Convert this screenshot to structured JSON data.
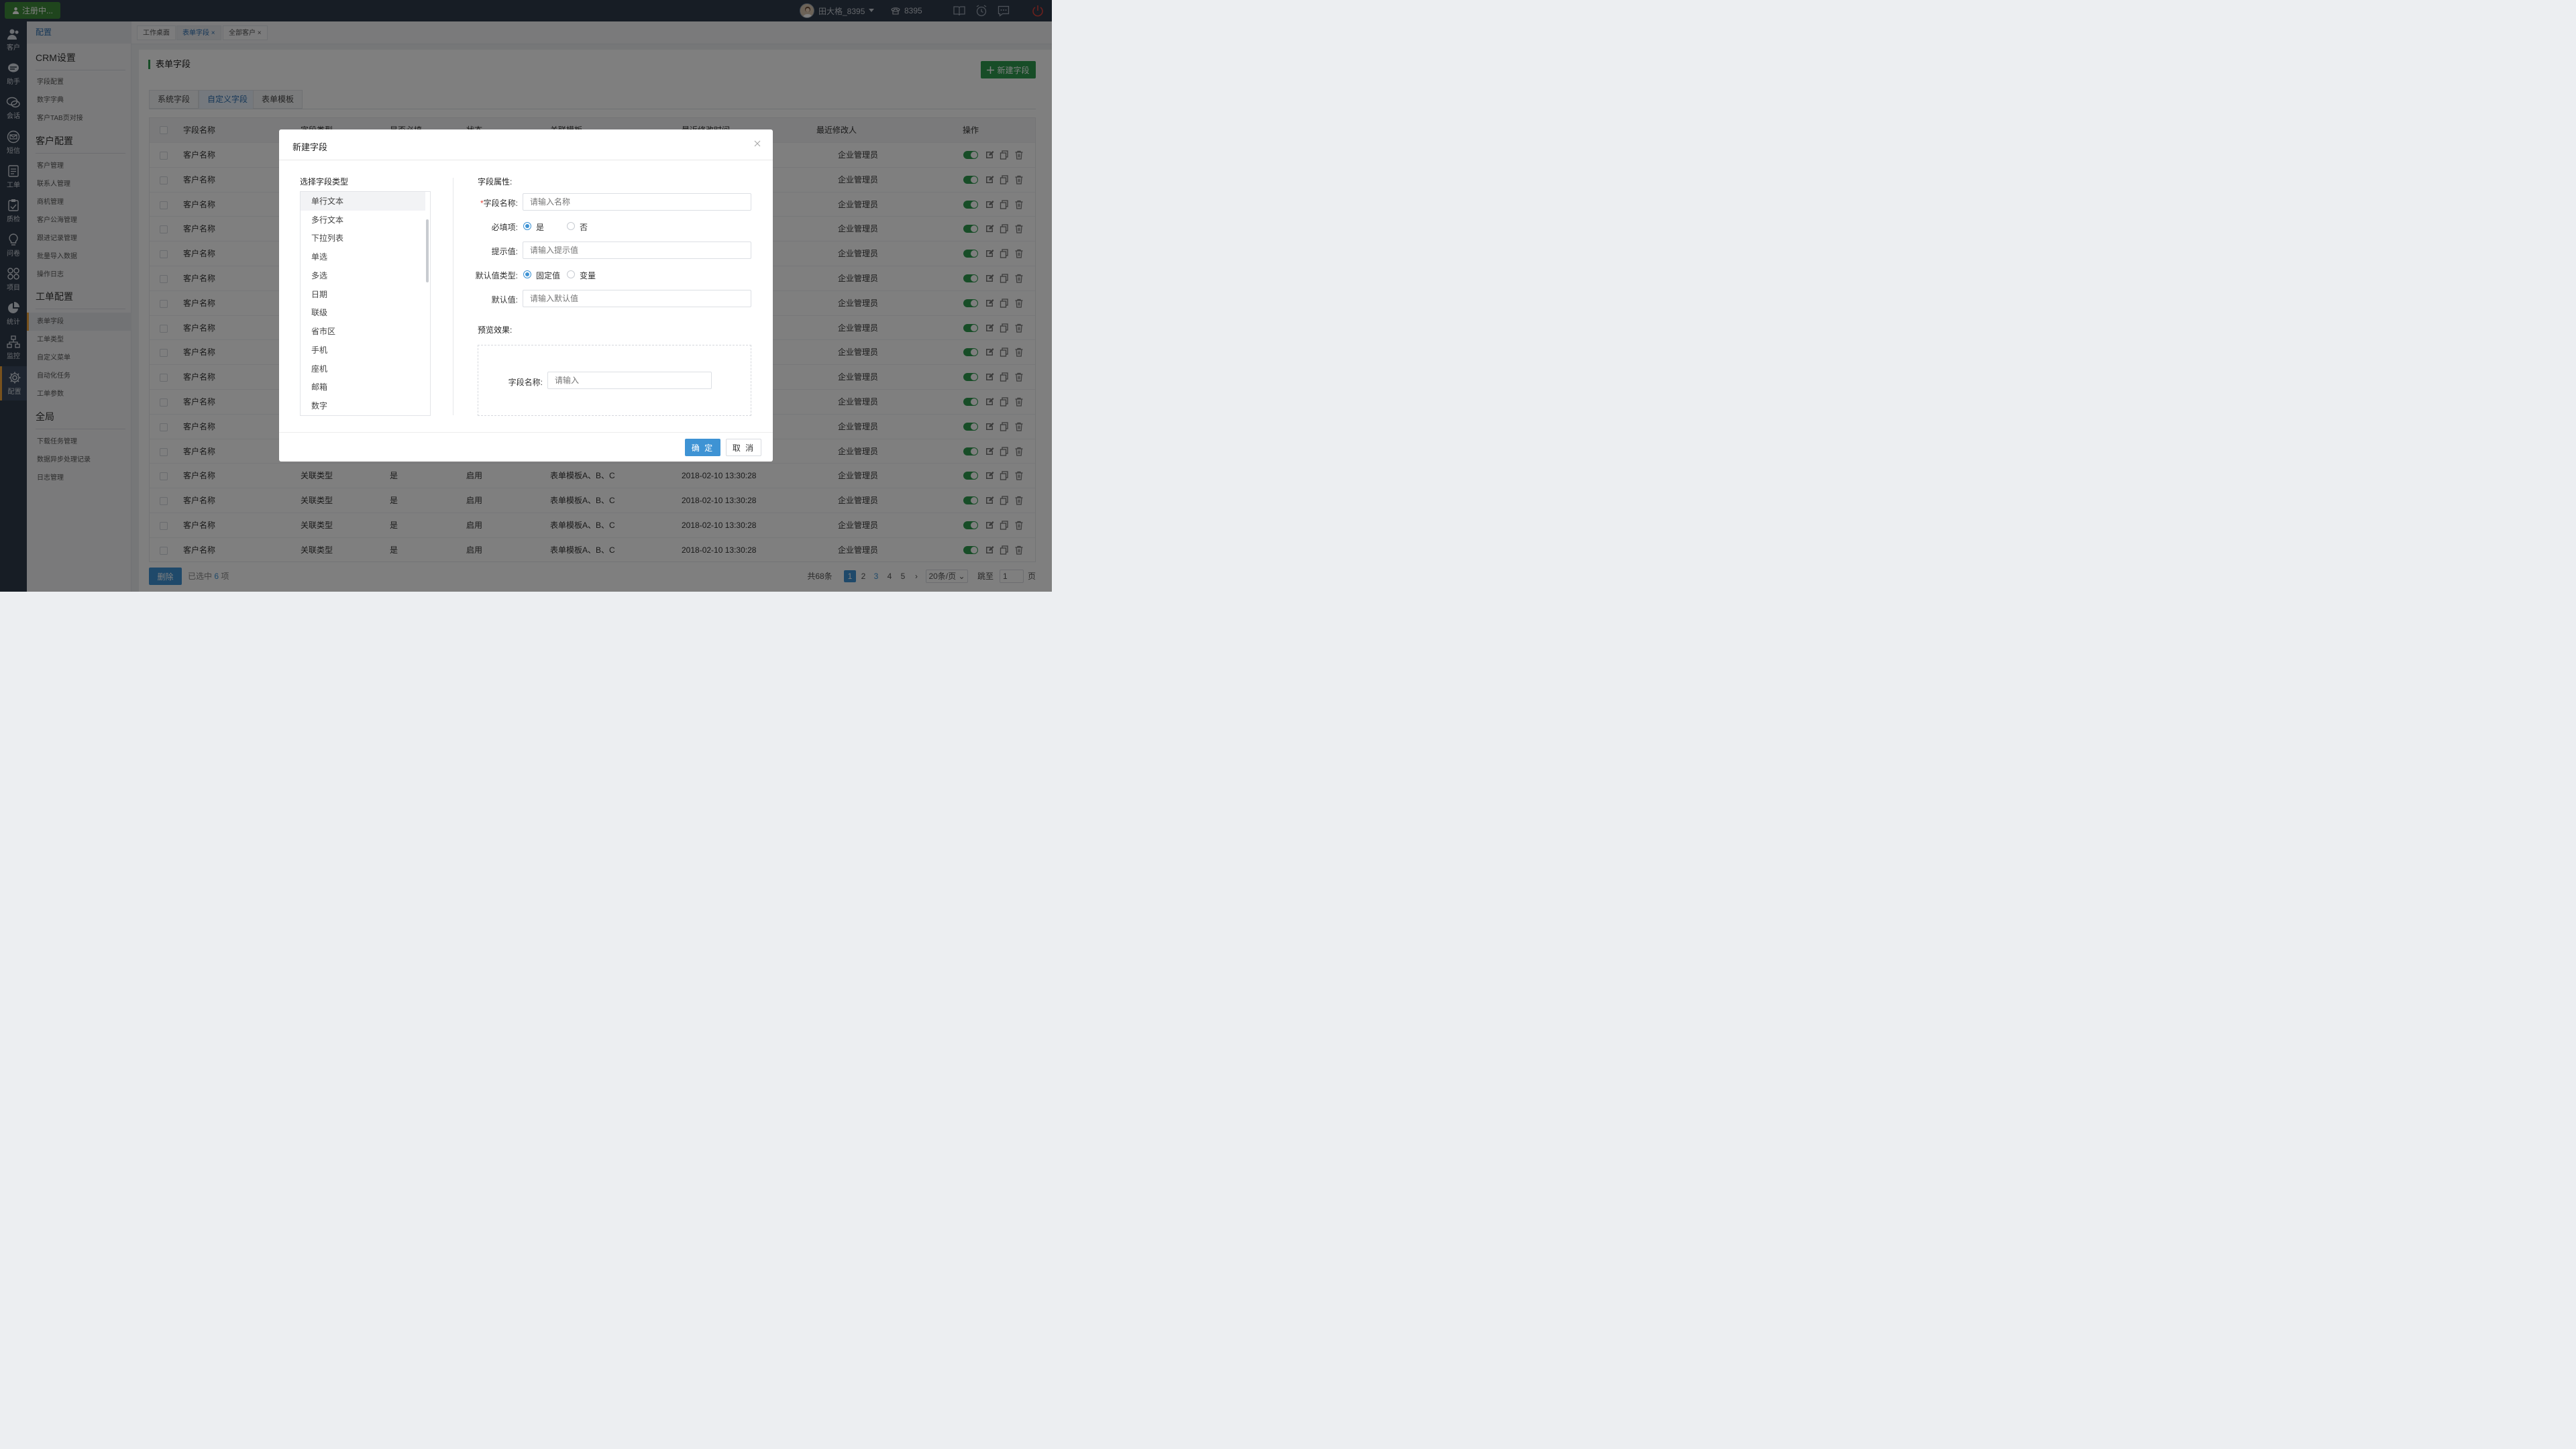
{
  "topbar": {
    "register_label": "注册中...",
    "user_name": "田大格_8395",
    "extension": "8395",
    "icons": [
      "book-icon",
      "alarm-icon",
      "message-icon",
      "power-icon"
    ]
  },
  "leftnav": [
    {
      "label": "客户",
      "icon": "people-icon"
    },
    {
      "label": "助手",
      "icon": "assistant-icon"
    },
    {
      "label": "会话",
      "icon": "chat-icon"
    },
    {
      "label": "短信",
      "icon": "mail-icon"
    },
    {
      "label": "工单",
      "icon": "ticket-icon"
    },
    {
      "label": "质检",
      "icon": "clipboard-icon"
    },
    {
      "label": "问卷",
      "icon": "bulb-icon"
    },
    {
      "label": "项目",
      "icon": "grid-icon"
    },
    {
      "label": "统计",
      "icon": "pie-icon"
    },
    {
      "label": "监控",
      "icon": "monitor-icon"
    },
    {
      "label": "配置",
      "icon": "gear-icon",
      "active": true
    }
  ],
  "sidebar": {
    "header": "配置",
    "groups": [
      {
        "title": "CRM设置",
        "items": [
          "字段配置",
          "数字字典",
          "客户TAB页对接"
        ]
      },
      {
        "title": "客户配置",
        "items": [
          "客户管理",
          "联系人管理",
          "商机管理",
          "客户公海管理",
          "跟进记录管理",
          "批量导入数据",
          "操作日志"
        ]
      },
      {
        "title": "工单配置",
        "items": [
          "表单字段",
          "工单类型",
          "自定义菜单",
          "自动化任务",
          "工单参数"
        ]
      },
      {
        "title": "全局",
        "items": [
          "下载任务管理",
          "数据异步处理记录",
          "日志管理"
        ]
      }
    ],
    "active_item": "表单字段"
  },
  "page_tabs": [
    "工作桌面",
    "表单字段",
    "全部客户"
  ],
  "page": {
    "title": "表单字段",
    "new_button": "新建字段",
    "field_tabs": [
      "系统字段",
      "自定义字段",
      "表单模板"
    ]
  },
  "table": {
    "columns": [
      "字段名称",
      "字段类型",
      "是否必填",
      "状态",
      "关联模板",
      "最近修改时间",
      "最近修改人",
      "操作"
    ],
    "rows": [
      {
        "name": "客户名称",
        "type": "关联类型",
        "required": "是",
        "status": "启用",
        "template": "表单模板A、B、C",
        "time": "2018-02-10 13:30:28",
        "modifier": "企业管理员"
      },
      {
        "name": "客户名称",
        "type": "关联类型",
        "required": "是",
        "status": "启用",
        "template": "表单模板A、B、C",
        "time": "2018-02-10 13:30:28",
        "modifier": "企业管理员"
      },
      {
        "name": "客户名称",
        "type": "关联类型",
        "required": "是",
        "status": "启用",
        "template": "表单模板A、B、C",
        "time": "2018-02-10 13:30:28",
        "modifier": "企业管理员"
      },
      {
        "name": "客户名称",
        "type": "关联类型",
        "required": "是",
        "status": "启用",
        "template": "表单模板A、B、C",
        "time": "2018-02-10 13:30:28",
        "modifier": "企业管理员"
      },
      {
        "name": "客户名称",
        "type": "关联类型",
        "required": "是",
        "status": "启用",
        "template": "表单模板A、B、C",
        "time": "2018-02-10 13:30:28",
        "modifier": "企业管理员"
      },
      {
        "name": "客户名称",
        "type": "关联类型",
        "required": "是",
        "status": "启用",
        "template": "表单模板A、B、C",
        "time": "2018-02-10 13:30:28",
        "modifier": "企业管理员"
      },
      {
        "name": "客户名称",
        "type": "关联类型",
        "required": "是",
        "status": "启用",
        "template": "表单模板A、B、C",
        "time": "2018-02-10 13:30:28",
        "modifier": "企业管理员"
      },
      {
        "name": "客户名称",
        "type": "关联类型",
        "required": "是",
        "status": "启用",
        "template": "表单模板A、B、C",
        "time": "2018-02-10 13:30:28",
        "modifier": "企业管理员"
      },
      {
        "name": "客户名称",
        "type": "关联类型",
        "required": "是",
        "status": "启用",
        "template": "表单模板A、B、C",
        "time": "2018-02-10 13:30:28",
        "modifier": "企业管理员"
      },
      {
        "name": "客户名称",
        "type": "关联类型",
        "required": "是",
        "status": "启用",
        "template": "表单模板A、B、C",
        "time": "2018-02-10 13:30:28",
        "modifier": "企业管理员"
      },
      {
        "name": "客户名称",
        "type": "关联类型",
        "required": "是",
        "status": "启用",
        "template": "表单模板A、B、C",
        "time": "2018-02-10 13:30:28",
        "modifier": "企业管理员"
      },
      {
        "name": "客户名称",
        "type": "关联类型",
        "required": "是",
        "status": "启用",
        "template": "表单模板A、B、C",
        "time": "2018-02-10 13:30:28",
        "modifier": "企业管理员"
      },
      {
        "name": "客户名称",
        "type": "关联类型",
        "required": "是",
        "status": "启用",
        "template": "表单模板A、B、C",
        "time": "2018-02-10 13:30:28",
        "modifier": "企业管理员"
      },
      {
        "name": "客户名称",
        "type": "关联类型",
        "required": "是",
        "status": "启用",
        "template": "表单模板A、B、C",
        "time": "2018-02-10 13:30:28",
        "modifier": "企业管理员"
      },
      {
        "name": "客户名称",
        "type": "关联类型",
        "required": "是",
        "status": "启用",
        "template": "表单模板A、B、C",
        "time": "2018-02-10 13:30:28",
        "modifier": "企业管理员"
      },
      {
        "name": "客户名称",
        "type": "关联类型",
        "required": "是",
        "status": "启用",
        "template": "表单模板A、B、C",
        "time": "2018-02-10 13:30:28",
        "modifier": "企业管理员"
      },
      {
        "name": "客户名称",
        "type": "关联类型",
        "required": "是",
        "status": "启用",
        "template": "表单模板A、B、C",
        "time": "2018-02-10 13:30:28",
        "modifier": "企业管理员"
      }
    ]
  },
  "footer": {
    "delete_label": "删除",
    "selected_prefix": "已选中",
    "selected_count": "6",
    "selected_suffix": "项",
    "total": "共68条",
    "pages": [
      "1",
      "2",
      "3",
      "4",
      "5"
    ],
    "current_page": "1",
    "page_size": "20条/页",
    "jump_label": "跳至",
    "jump_value": "1",
    "page_unit": "页"
  },
  "modal": {
    "title": "新建字段",
    "type_title": "选择字段类型",
    "types": [
      "单行文本",
      "多行文本",
      "下拉列表",
      "单选",
      "多选",
      "日期",
      "联级",
      "省市区",
      "手机",
      "座机",
      "邮箱",
      "数字"
    ],
    "selected_type": "单行文本",
    "attr_title": "字段属性:",
    "name_label": "字段名称:",
    "name_required_mark": "*",
    "name_placeholder": "请输入名称",
    "required_label": "必填项:",
    "required_options": [
      "是",
      "否"
    ],
    "required_value": "是",
    "hint_label": "提示值:",
    "hint_placeholder": "请输入提示值",
    "default_type_label": "默认值类型:",
    "default_type_options": [
      "固定值",
      "变量"
    ],
    "default_type_value": "固定值",
    "default_label": "默认值:",
    "default_placeholder": "请输入默认值",
    "preview_title": "预览效果:",
    "preview_label": "字段名称:",
    "preview_placeholder": "请输入",
    "ok_label": "确 定",
    "cancel_label": "取 消"
  },
  "colors": {
    "accent_blue": "#3e93d4",
    "accent_green": "#2e9b4f",
    "nav_bg": "#2f3a4a",
    "active_marker": "#f0a43a"
  }
}
